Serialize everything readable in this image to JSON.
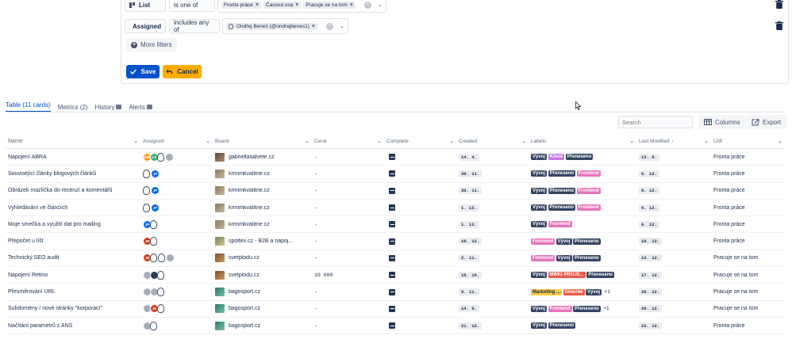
{
  "filters": [
    {
      "field": "List",
      "icon": "list-icon",
      "operator": "is one of",
      "values": [
        "Fronta práce",
        "Časová osa",
        "Pracuje se na tom"
      ]
    },
    {
      "field": "Assigned",
      "icon": "user-icon",
      "operator": "includes any of",
      "values": [
        "Ondřej Beneš (@ondrejbenes1)"
      ]
    }
  ],
  "more_filters_label": "More filters",
  "save_label": "Save",
  "cancel_label": "Cancel",
  "tabs": [
    {
      "label": "Table (11 cards)",
      "active": true,
      "badge": false
    },
    {
      "label": "Metrics (2)",
      "active": false,
      "badge": false
    },
    {
      "label": "History",
      "active": false,
      "badge": true
    },
    {
      "label": "Alerts",
      "active": false,
      "badge": true
    }
  ],
  "search_placeholder": "Search",
  "columns_label": "Columns",
  "export_label": "Export",
  "columns": [
    {
      "key": "name",
      "label": "Name",
      "sort": ""
    },
    {
      "key": "assigned",
      "label": "Assigned",
      "sort": ""
    },
    {
      "key": "board",
      "label": "Board",
      "sort": ""
    },
    {
      "key": "cena",
      "label": "Cena",
      "sort": ""
    },
    {
      "key": "complete",
      "label": "Complete",
      "sort": ""
    },
    {
      "key": "created",
      "label": "Created",
      "sort": ""
    },
    {
      "key": "labels",
      "label": "Labels",
      "sort": ""
    },
    {
      "key": "lastmod",
      "label": "Last Modified",
      "sort": "↑"
    },
    {
      "key": "list",
      "label": "List",
      "sort": ""
    }
  ],
  "label_colors": {
    "Vývoj": "#344563",
    "Klient": "#c377e0",
    "Přeneseno": "#344563",
    "Frontend": "#e774bb",
    "MIMO PROJE...": "#eb5a46",
    "Marketing ...": "#f5cd47",
    "Důležité": "#eb5a46"
  },
  "rows": [
    {
      "name": "Napojení ABRA",
      "assigned": [
        {
          "t": "KW",
          "c": "#ff991f"
        },
        {
          "t": "LF",
          "c": "#36b37e"
        },
        {
          "t": "ghost"
        },
        {
          "t": "grey"
        }
      ],
      "board": "gabriellasalvete.cz",
      "thumb": 0,
      "cena": "-",
      "created": "14. 4.",
      "labels": [
        "Vývoj",
        "Klient",
        "Přeneseno"
      ],
      "more": "",
      "lastmod": "13. 8.",
      "list": "Fronta práce"
    },
    {
      "name": "Související články blogových článků",
      "assigned": [
        {
          "t": "ghost"
        },
        {
          "t": "JP",
          "c": "#0065ff"
        }
      ],
      "board": "krmimkvalitne.cz",
      "thumb": 1,
      "cena": "-",
      "created": "30. 11.",
      "labels": [
        "Vývoj",
        "Přeneseno",
        "Frontend"
      ],
      "more": "",
      "lastmod": "6. 12.",
      "list": "Fronta práce"
    },
    {
      "name": "Obrázek mazlíčka do recenzí a komentářů",
      "assigned": [
        {
          "t": "ghost"
        },
        {
          "t": "JP",
          "c": "#0065ff"
        }
      ],
      "board": "krmimkvalitne.cz",
      "thumb": 1,
      "cena": "-",
      "created": "30. 11.",
      "labels": [
        "Vývoj",
        "Přeneseno",
        "Frontend"
      ],
      "more": "",
      "lastmod": "6. 12.",
      "list": "Fronta práce"
    },
    {
      "name": "Vyhledávání ve článcích",
      "assigned": [
        {
          "t": "ghost"
        },
        {
          "t": "JP",
          "c": "#0065ff"
        }
      ],
      "board": "krmimkvalitne.cz",
      "thumb": 1,
      "cena": "-",
      "created": "1. 12.",
      "labels": [
        "Vývoj",
        "Přeneseno",
        "Frontend"
      ],
      "more": "",
      "lastmod": "6. 12.",
      "list": "Fronta práce"
    },
    {
      "name": "Moje smečka a využití dat pro mailing",
      "assigned": [
        {
          "t": "JP",
          "c": "#0065ff"
        },
        {
          "t": "ghost"
        }
      ],
      "board": "krmimkvalitne.cz",
      "thumb": 1,
      "cena": "-",
      "created": "1. 12.",
      "labels": [
        "Vývoj",
        "Frontend"
      ],
      "more": "",
      "lastmod": "6. 12.",
      "list": "Fronta práce"
    },
    {
      "name": "Přepočet u líšt",
      "assigned": [
        {
          "t": "JB",
          "c": "#de350b"
        },
        {
          "t": "ghost"
        }
      ],
      "board": "spoltex.cz - B2B a napoj...",
      "thumb": 2,
      "cena": "-",
      "created": "10. 12.",
      "labels": [
        "Frontend",
        "Vývoj",
        "Přeneseno"
      ],
      "more": "",
      "lastmod": "10. 12.",
      "list": "Fronta práce"
    },
    {
      "name": "Technický SEO audit",
      "assigned": [
        {
          "t": "JB",
          "c": "#de350b"
        },
        {
          "t": "ghost"
        },
        {
          "t": "ghost"
        },
        {
          "t": "grey"
        }
      ],
      "board": "svetplodu.cz",
      "thumb": 3,
      "cena": "-",
      "created": "2. 11.",
      "labels": [
        "Frontend",
        "Vývoj",
        "Přeneseno"
      ],
      "more": "",
      "lastmod": "13. 12.",
      "list": "Pracuje se na tom"
    },
    {
      "name": "Napojení Retino",
      "assigned": [
        {
          "t": "grey"
        },
        {
          "t": "dark"
        },
        {
          "t": "ghost"
        }
      ],
      "board": "svetplodu.cz",
      "thumb": 3,
      "cena": "10 000",
      "created": "15. 10.",
      "labels": [
        "Vývoj",
        "MIMO PROJE...",
        "Přeneseno"
      ],
      "more": "",
      "lastmod": "17. 12.",
      "list": "Pracuje se na tom"
    },
    {
      "name": "Přesměrování URL",
      "assigned": [
        {
          "t": "grey"
        },
        {
          "t": "grey"
        },
        {
          "t": "ghost"
        }
      ],
      "board": "bagosport.cz",
      "thumb": 4,
      "cena": "-",
      "created": "9. 11.",
      "labels": [
        "Marketing ...",
        "Důležité",
        "Vývoj"
      ],
      "more": "+1",
      "lastmod": "20. 12.",
      "list": "Pracuje se na tom"
    },
    {
      "name": "Subdomény / nové stránky \"korporací\"",
      "assigned": [
        {
          "t": "grey"
        },
        {
          "t": "JB",
          "c": "#de350b"
        },
        {
          "t": "ghost"
        }
      ],
      "board": "bagosport.cz",
      "thumb": 4,
      "cena": "-",
      "created": "14. 9.",
      "labels": [
        "Vývoj",
        "Frontend",
        "Přeneseno"
      ],
      "more": "+1",
      "lastmod": "20. 12.",
      "list": "Pracuje se na tom"
    },
    {
      "name": "Načítání parametrů z ANS",
      "assigned": [
        {
          "t": "grey"
        },
        {
          "t": "ghost"
        }
      ],
      "board": "bagosport.cz",
      "thumb": 4,
      "cena": "-",
      "created": "21. 12.",
      "labels": [
        "Vývoj",
        "Přeneseno"
      ],
      "more": "",
      "lastmod": "22. 12.",
      "list": "Fronta práce"
    }
  ]
}
